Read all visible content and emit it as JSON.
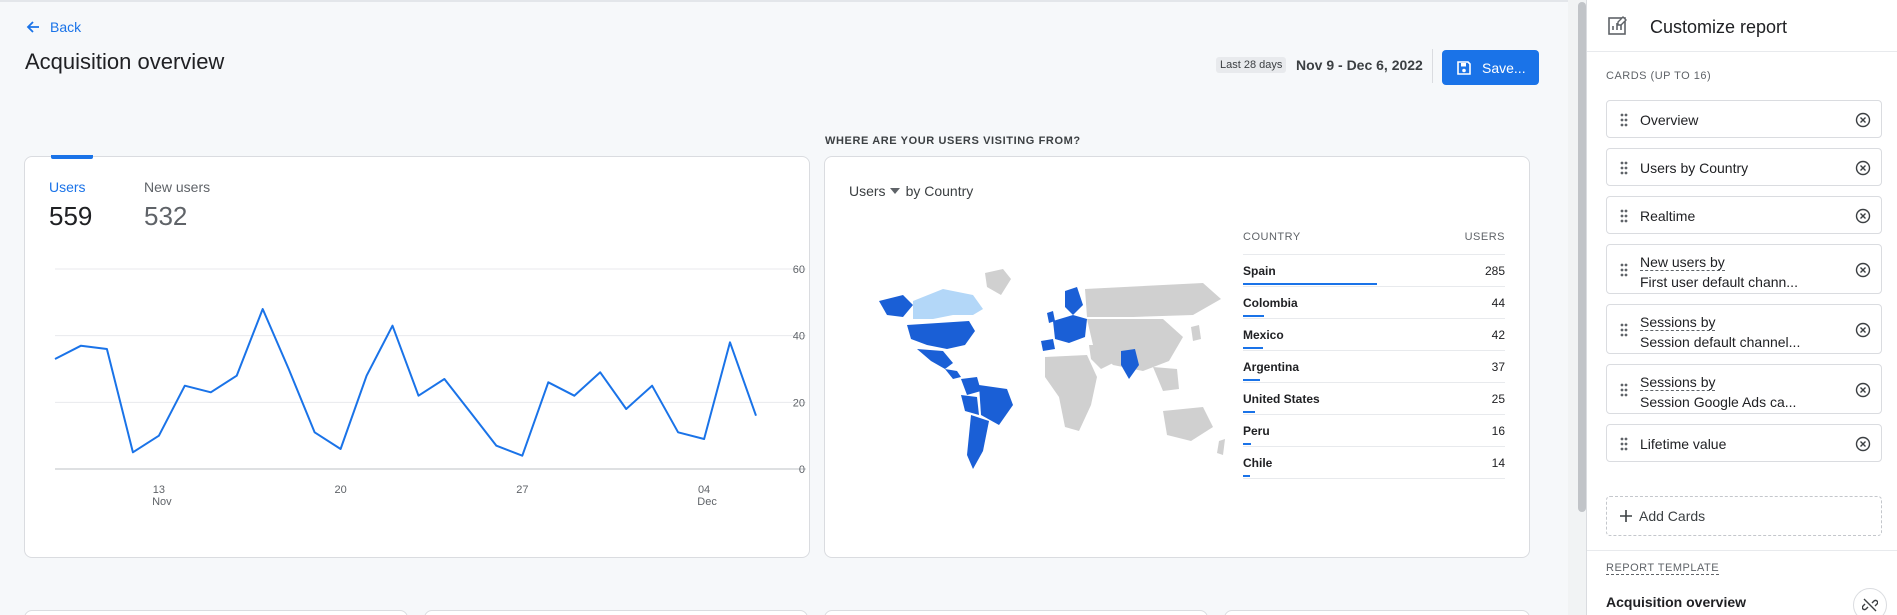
{
  "header": {
    "back_label": "Back",
    "page_title": "Acquisition overview",
    "date_chip": "Last 28 days",
    "date_range": "Nov 9 - Dec 6, 2022",
    "save_label": "Save..."
  },
  "overview_card": {
    "metrics": [
      {
        "label": "Users",
        "value": "559",
        "selected": true
      },
      {
        "label": "New users",
        "value": "532",
        "selected": false
      }
    ],
    "chart_data": {
      "type": "line",
      "series": [
        {
          "name": "Users",
          "values": [
            33,
            37,
            36,
            5,
            10,
            25,
            23,
            28,
            48,
            30,
            11,
            6,
            28,
            43,
            22,
            27,
            17,
            7,
            4,
            26,
            22,
            29,
            18,
            25,
            11,
            9,
            38,
            16
          ]
        }
      ],
      "x_tick_labels": [
        {
          "day": "13",
          "month": "Nov"
        },
        {
          "day": "20",
          "month": ""
        },
        {
          "day": "27",
          "month": ""
        },
        {
          "day": "04",
          "month": "Dec"
        }
      ],
      "y_ticks": [
        "60",
        "40",
        "20",
        "0"
      ],
      "ylim": [
        0,
        60
      ],
      "grid": true,
      "accent": "#1a73e8"
    }
  },
  "country_card": {
    "section_label": "WHERE ARE YOUR USERS VISITING FROM?",
    "dimension_metric": "Users",
    "dimension_suffix": "by Country",
    "table": {
      "columns": [
        "COUNTRY",
        "USERS"
      ],
      "rows": [
        {
          "country": "Spain",
          "users": 285
        },
        {
          "country": "Colombia",
          "users": 44
        },
        {
          "country": "Mexico",
          "users": 42
        },
        {
          "country": "Argentina",
          "users": 37
        },
        {
          "country": "United States",
          "users": 25
        },
        {
          "country": "Peru",
          "users": 16
        },
        {
          "country": "Chile",
          "users": 14
        }
      ]
    },
    "map_colors": {
      "high": "#1a5fd6",
      "mid": "#b3d7f8",
      "none": "#d0d0d0"
    }
  },
  "panel": {
    "title": "Customize report",
    "cards_title": "CARDS (UP TO 16)",
    "cards": [
      {
        "line1": "Overview",
        "line2": ""
      },
      {
        "line1": "Users by Country",
        "line2": ""
      },
      {
        "line1": "Realtime",
        "line2": ""
      },
      {
        "line1": "New users by",
        "line2": "First user default chann..."
      },
      {
        "line1": "Sessions by",
        "line2": "Session default channel..."
      },
      {
        "line1": "Sessions by",
        "line2": "Session Google Ads ca..."
      },
      {
        "line1": "Lifetime value",
        "line2": ""
      }
    ],
    "add_cards_label": "Add Cards",
    "template_title": "REPORT TEMPLATE",
    "template_name": "Acquisition overview"
  }
}
